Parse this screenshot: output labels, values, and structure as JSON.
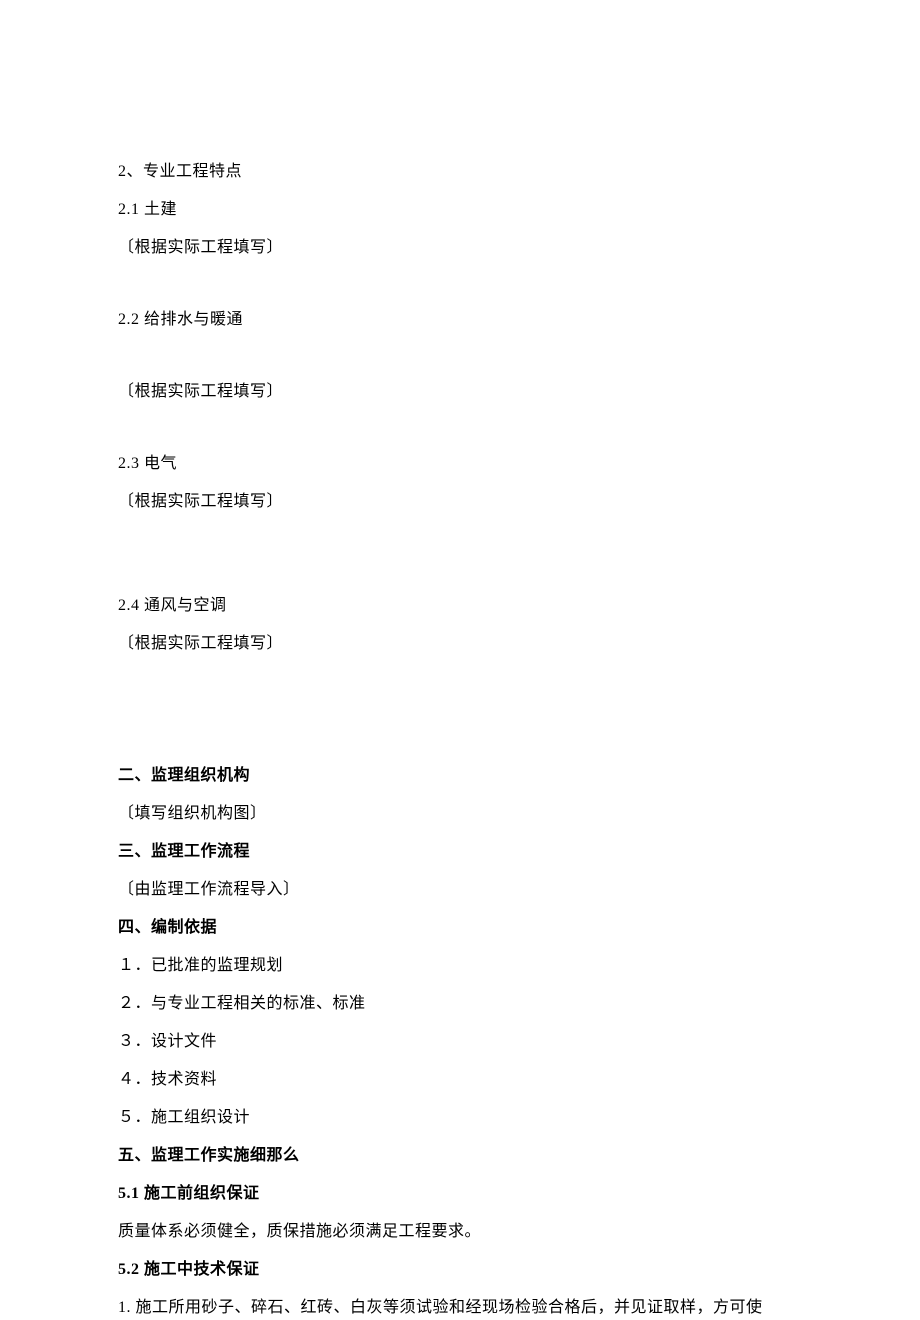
{
  "section2": {
    "title": "2、专业工程特点",
    "sub1": {
      "heading": "2.1 土建",
      "note": "〔根据实际工程填写〕"
    },
    "sub2": {
      "heading": "2.2 给排水与暖通",
      "note": "〔根据实际工程填写〕"
    },
    "sub3": {
      "heading": "2.3 电气",
      "note": "〔根据实际工程填写〕"
    },
    "sub4": {
      "heading": "2.4 通风与空调",
      "note": "〔根据实际工程填写〕"
    }
  },
  "heading2": "二、监理组织机构",
  "note2": "〔填写组织机构图〕",
  "heading3": "三、监理工作流程",
  "note3": "〔由监理工作流程导入〕",
  "heading4": "四、编制依据",
  "list4": {
    "item1": "１．已批准的监理规划",
    "item2": "２．与专业工程相关的标准、标准",
    "item3": "３．设计文件",
    "item4": "４．技术资料",
    "item5": "５．施工组织设计"
  },
  "heading5": "五、监理工作实施细那么",
  "sub51": {
    "heading": "5.1 施工前组织保证",
    "text": "质量体系必须健全，质保措施必须满足工程要求。"
  },
  "sub52": {
    "heading": "5.2 施工中技术保证",
    "item1": "1. 施工所用砂子、碎石、红砖、白灰等须试验和经现场检验合格后，并见证取样，方可使"
  }
}
